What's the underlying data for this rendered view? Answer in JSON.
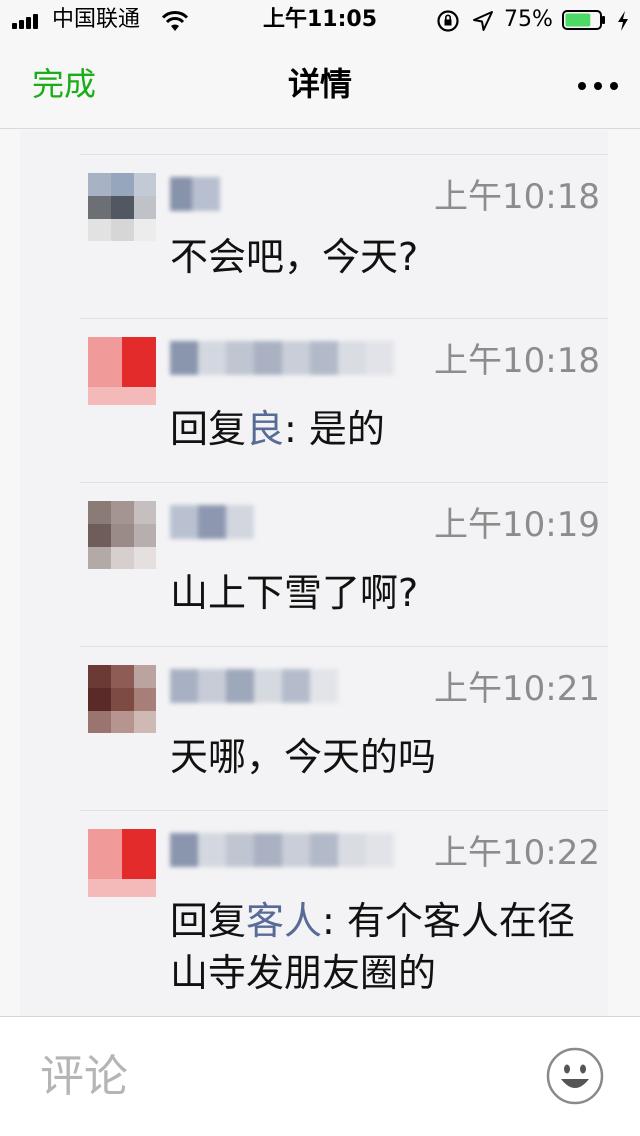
{
  "status_bar": {
    "carrier": "中国联通",
    "time": "上午11:05",
    "battery": "75%",
    "battery_level": 0.75,
    "icons": [
      "signal-icon",
      "wifi-icon",
      "rotation-lock-icon",
      "location-arrow-icon",
      "battery-icon",
      "charging-icon"
    ]
  },
  "nav": {
    "done_label": "完成",
    "title": "详情",
    "more_icon": "more-dots-icon"
  },
  "comments": [
    {
      "time": "上午10:18",
      "text": "不会吧，今天?"
    },
    {
      "time": "上午10:18",
      "reply_prefix": "回复",
      "reply_to": "良",
      "reply_sep": ": ",
      "text": "是的"
    },
    {
      "time": "上午10:19",
      "text": "山上下雪了啊?"
    },
    {
      "time": "上午10:21",
      "text": "天哪，今天的吗"
    },
    {
      "time": "上午10:22",
      "reply_prefix": "回复",
      "reply_to": "客人",
      "reply_sep": ": ",
      "text": "有个客人在径山寺发朋友圈的"
    }
  ],
  "input": {
    "placeholder": "评论",
    "emoji_icon": "emoji-smile-icon"
  },
  "colors": {
    "accent_green": "#1aad19",
    "link_blue": "#576b95",
    "time_gray": "#8c8c8c"
  }
}
